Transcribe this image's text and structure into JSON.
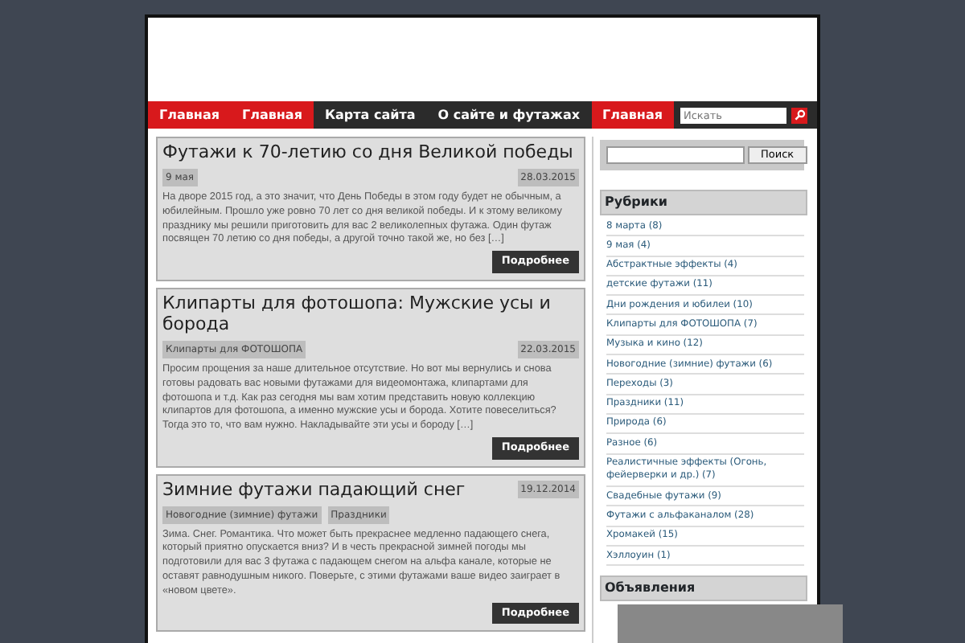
{
  "nav": {
    "items": [
      {
        "label": "Главная",
        "highlighted": true
      },
      {
        "label": "Главная",
        "highlighted": true
      },
      {
        "label": "Карта сайта",
        "highlighted": false
      },
      {
        "label": "О сайте и футажах",
        "highlighted": false
      },
      {
        "label": "Главная",
        "highlighted": true
      }
    ],
    "search_placeholder": "Искать"
  },
  "posts": [
    {
      "title": "Футажи к 70-летию со дня Великой победы",
      "date": "28.03.2015",
      "tags": [
        "9 мая"
      ],
      "excerpt": "На дворе 2015 год, а это значит, что День Победы в этом году будет не обычным, а юбилейным. Прошло уже ровно 70 лет со дня великой победы. И к этому великому празднику мы решили приготовить для вас 2 великолепных футажа. Один футаж посвящен 70 летию со дня победы, а другой точно такой же, но без […]",
      "button": "Подробнее"
    },
    {
      "title": "Клипарты для фотошопа: Мужские усы и борода",
      "date": "22.03.2015",
      "tags": [
        "Клипарты для ФОТОШОПА"
      ],
      "excerpt": "Просим прощения за наше длительное отсутствие. Но вот мы вернулись и снова готовы радовать вас новыми футажами для видеомонтажа, клипартами для фотошопа и т.д. Как раз сегодня мы вам хотим представить новую коллекцию клипартов для фотошопа, а именно мужские усы и борода. Хотите повеселиться? Тогда это то, что вам нужно. Накладывайте эти усы и бороду […]",
      "button": "Подробнее"
    },
    {
      "title": "Зимние футажи падающий снег",
      "date": "19.12.2014",
      "tags": [
        "Новогодние (зимние) футажи",
        "Праздники"
      ],
      "excerpt": "Зима. Снег. Романтика. Что может быть прекраснее медленно падающего снега, который приятно опускается вниз? И в честь прекрасной зимней погоды мы подготовили для вас 3 футажа с падающем снегом на альфа канале, которые не оставят равнодушным никого. Поверьте, с этими футажами ваше видео заиграет в «новом цвете».",
      "button": "Подробнее"
    }
  ],
  "sidebar": {
    "search_button": "Поиск",
    "categories_title": "Рубрики",
    "categories": [
      "8 марта (8)",
      "9 мая (4)",
      "Абстрактные эффекты (4)",
      "детские футажи (11)",
      "Дни рождения и юбилеи (10)",
      "Клипарты для ФОТОШОПА (7)",
      "Музыка и кино (12)",
      "Новогодние (зимние) футажи (6)",
      "Переходы (3)",
      "Праздники (11)",
      "Природа (6)",
      "Разное (6)",
      "Реалистичные эффекты (Огонь, фейерверки и др.) (7)",
      "Свадебные футажи (9)",
      "Футажи с альфаканалом (28)",
      "Хромакей (15)",
      "Хэллоуин (1)"
    ],
    "ads_title": "Объявления"
  }
}
